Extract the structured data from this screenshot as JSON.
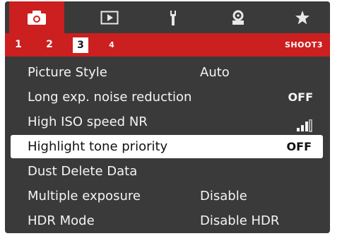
{
  "tabs": [
    {
      "name": "camera-icon",
      "active": true
    },
    {
      "name": "playback-icon",
      "active": false
    },
    {
      "name": "wrench-icon",
      "active": false
    },
    {
      "name": "custom-function-icon",
      "active": false
    },
    {
      "name": "star-icon",
      "active": false
    }
  ],
  "subtabs": {
    "pages": [
      "1",
      "2",
      "3",
      "4"
    ],
    "active_page": "3",
    "section_label": "SHOOT3"
  },
  "menu": {
    "items": [
      {
        "label": "Picture Style",
        "value": "Auto"
      },
      {
        "label": "Long exp. noise reduction",
        "value": "OFF"
      },
      {
        "label": "High ISO speed NR",
        "value_icon": "nr-level-bars-icon"
      },
      {
        "label": "Highlight tone priority",
        "value": "OFF",
        "selected": true
      },
      {
        "label": "Dust Delete Data",
        "value": ""
      },
      {
        "label": "Multiple exposure",
        "value": "Disable"
      },
      {
        "label": "HDR Mode",
        "value": "Disable HDR"
      }
    ]
  },
  "colors": {
    "accent": "#cc1f1f",
    "background": "#3a3a3a",
    "text": "#f4f4f4",
    "selected_bg": "#ffffff"
  }
}
